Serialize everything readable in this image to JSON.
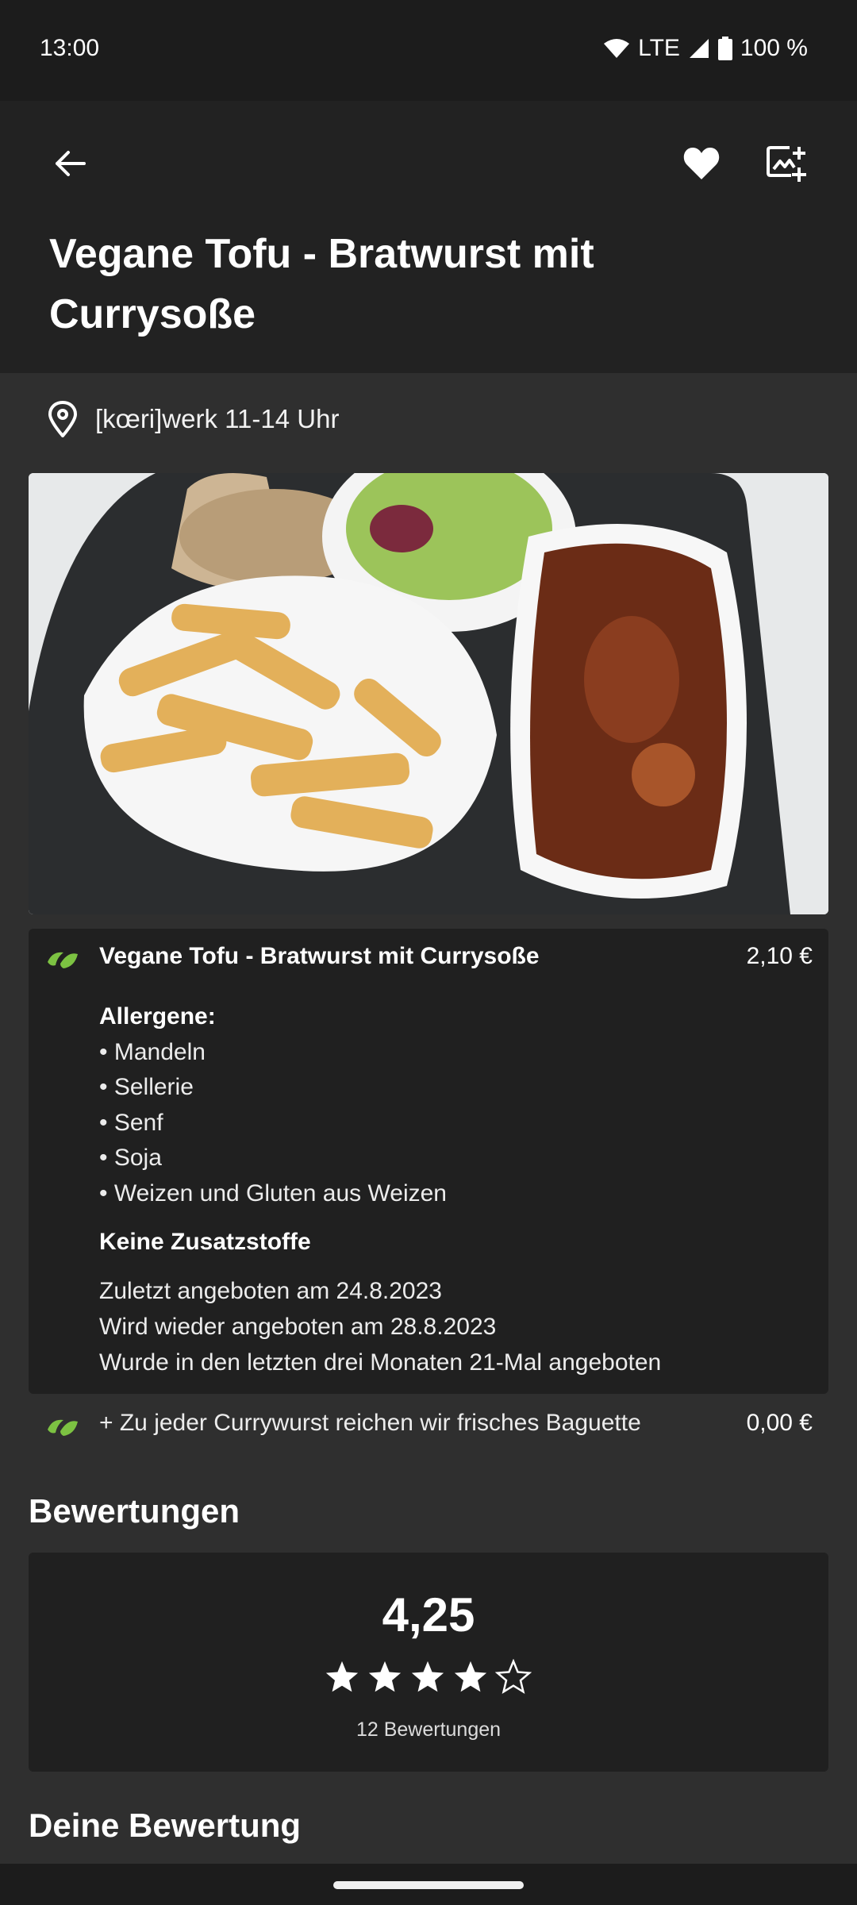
{
  "status_bar": {
    "time": "13:00",
    "network": "LTE",
    "battery": "100 %",
    "icons": [
      "wifi-icon",
      "signal-icon",
      "battery-icon"
    ]
  },
  "app_bar": {
    "icons": [
      "back-arrow-icon",
      "heart-icon",
      "add-image-icon"
    ],
    "title": "Vegane Tofu - Bratwurst mit Currysoße"
  },
  "location": {
    "icon": "location-pin-icon",
    "text": "[kœri]werk 11-14 Uhr"
  },
  "photo": {
    "alt_subject": "food-photo"
  },
  "main_dish": {
    "icon": "leaf-icon",
    "name": "Vegane Tofu - Bratwurst mit Currysoße",
    "price": "2,10 €",
    "allergens_heading": "Allergene:",
    "allergens": [
      "• Mandeln",
      "• Sellerie",
      "• Senf",
      "• Soja",
      "• Weizen und Gluten aus Weizen"
    ],
    "additives": "Keine Zusatzstoffe",
    "info": [
      "Zuletzt angeboten am 24.8.2023",
      "Wird wieder angeboten am 28.8.2023",
      "Wurde in den letzten drei Monaten 21-Mal angeboten"
    ]
  },
  "side_dish": {
    "icon": "leaf-icon",
    "name": "+ Zu jeder Currywurst reichen wir frisches Baguette",
    "price": "0,00 €"
  },
  "ratings": {
    "heading": "Bewertungen",
    "score": "4,25",
    "stars_filled": 4,
    "stars_total": 5,
    "count_text": "12 Bewertungen"
  },
  "own_rating": {
    "heading": "Deine Bewertung"
  },
  "colors": {
    "leaf": "#7cc242",
    "background": "#2f2f2f",
    "card": "#202020",
    "app_bar": "#222222"
  }
}
